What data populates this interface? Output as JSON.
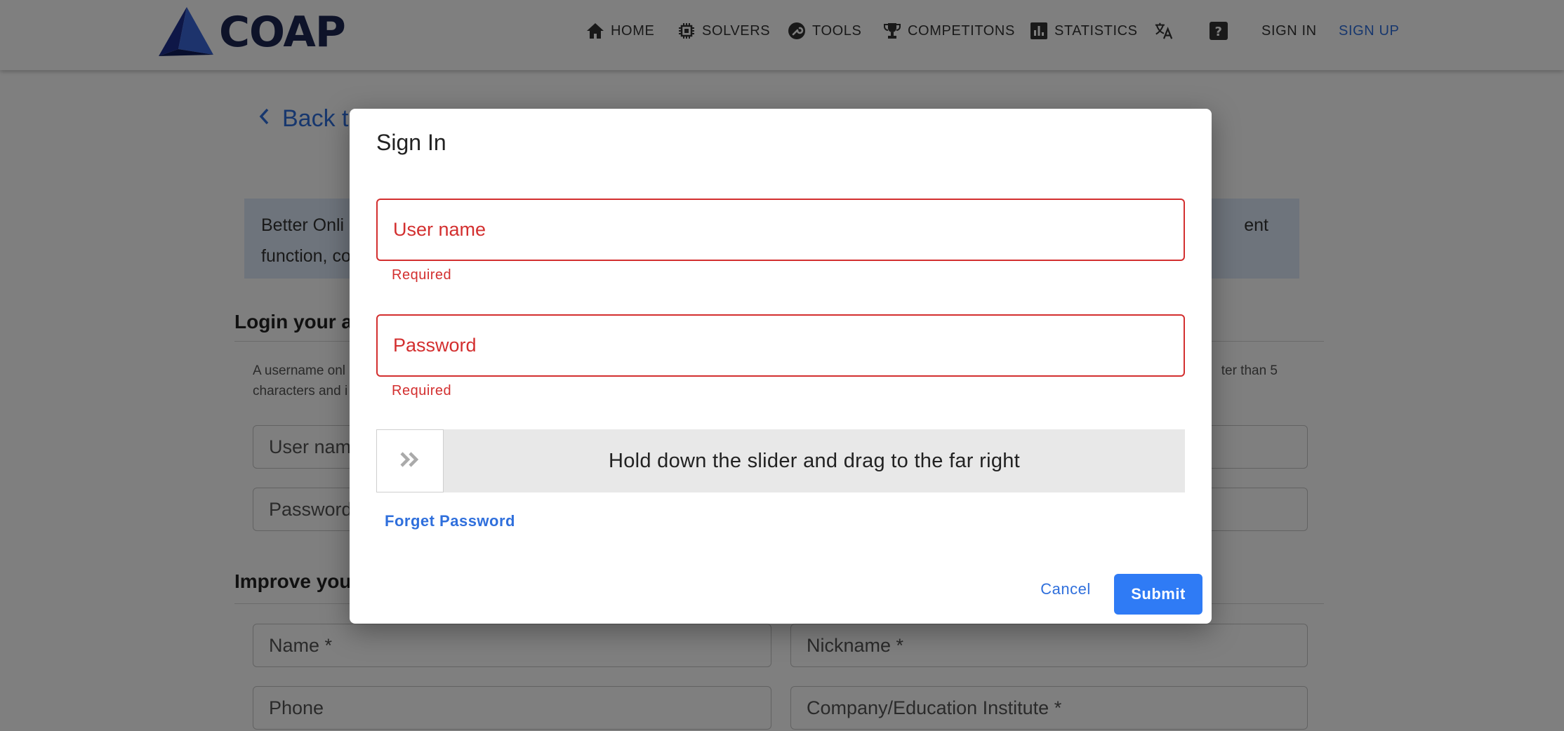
{
  "brand": {
    "name": "COAP",
    "color": "#1d2752",
    "accent": "#2f6fdc"
  },
  "nav": {
    "items": [
      {
        "label": "HOME",
        "icon": "home-icon"
      },
      {
        "label": "SOLVERS",
        "icon": "chip-icon"
      },
      {
        "label": "TOOLS",
        "icon": "wrench-icon"
      },
      {
        "label": "COMPETITONS",
        "icon": "trophy-icon"
      },
      {
        "label": "STATISTICS",
        "icon": "bar-chart-icon"
      }
    ],
    "language_icon": "translate-icon",
    "help_icon": "help-icon",
    "sign_in": "SIGN IN",
    "sign_up": "SIGN UP"
  },
  "page": {
    "back_link": "Back to",
    "info_line1_left": "Better Onli",
    "info_line1_right": "ent",
    "info_line2": "function, co",
    "login_title": "Login your a",
    "hint_line1_left": "A username onl",
    "hint_line1_right": "ter than 5",
    "hint_line2": "characters and i",
    "username_placeholder": "User name",
    "password_placeholder": "Password",
    "improve_title": "Improve your",
    "name_placeholder": "Name *",
    "nickname_placeholder": "Nickname *",
    "phone_placeholder": "Phone",
    "company_placeholder": "Company/Education Institute *"
  },
  "dialog": {
    "title": "Sign In",
    "username_label": "User name",
    "username_error": "Required",
    "password_label": "Password",
    "password_error": "Required",
    "slider_text": "Hold down the slider and drag to the far right",
    "slider_icon": "double-chevron-right-icon",
    "forget_password": "Forget Password",
    "cancel": "Cancel",
    "submit": "Submit",
    "error_color": "#d32f2f",
    "submit_color": "#2f7bf5"
  }
}
